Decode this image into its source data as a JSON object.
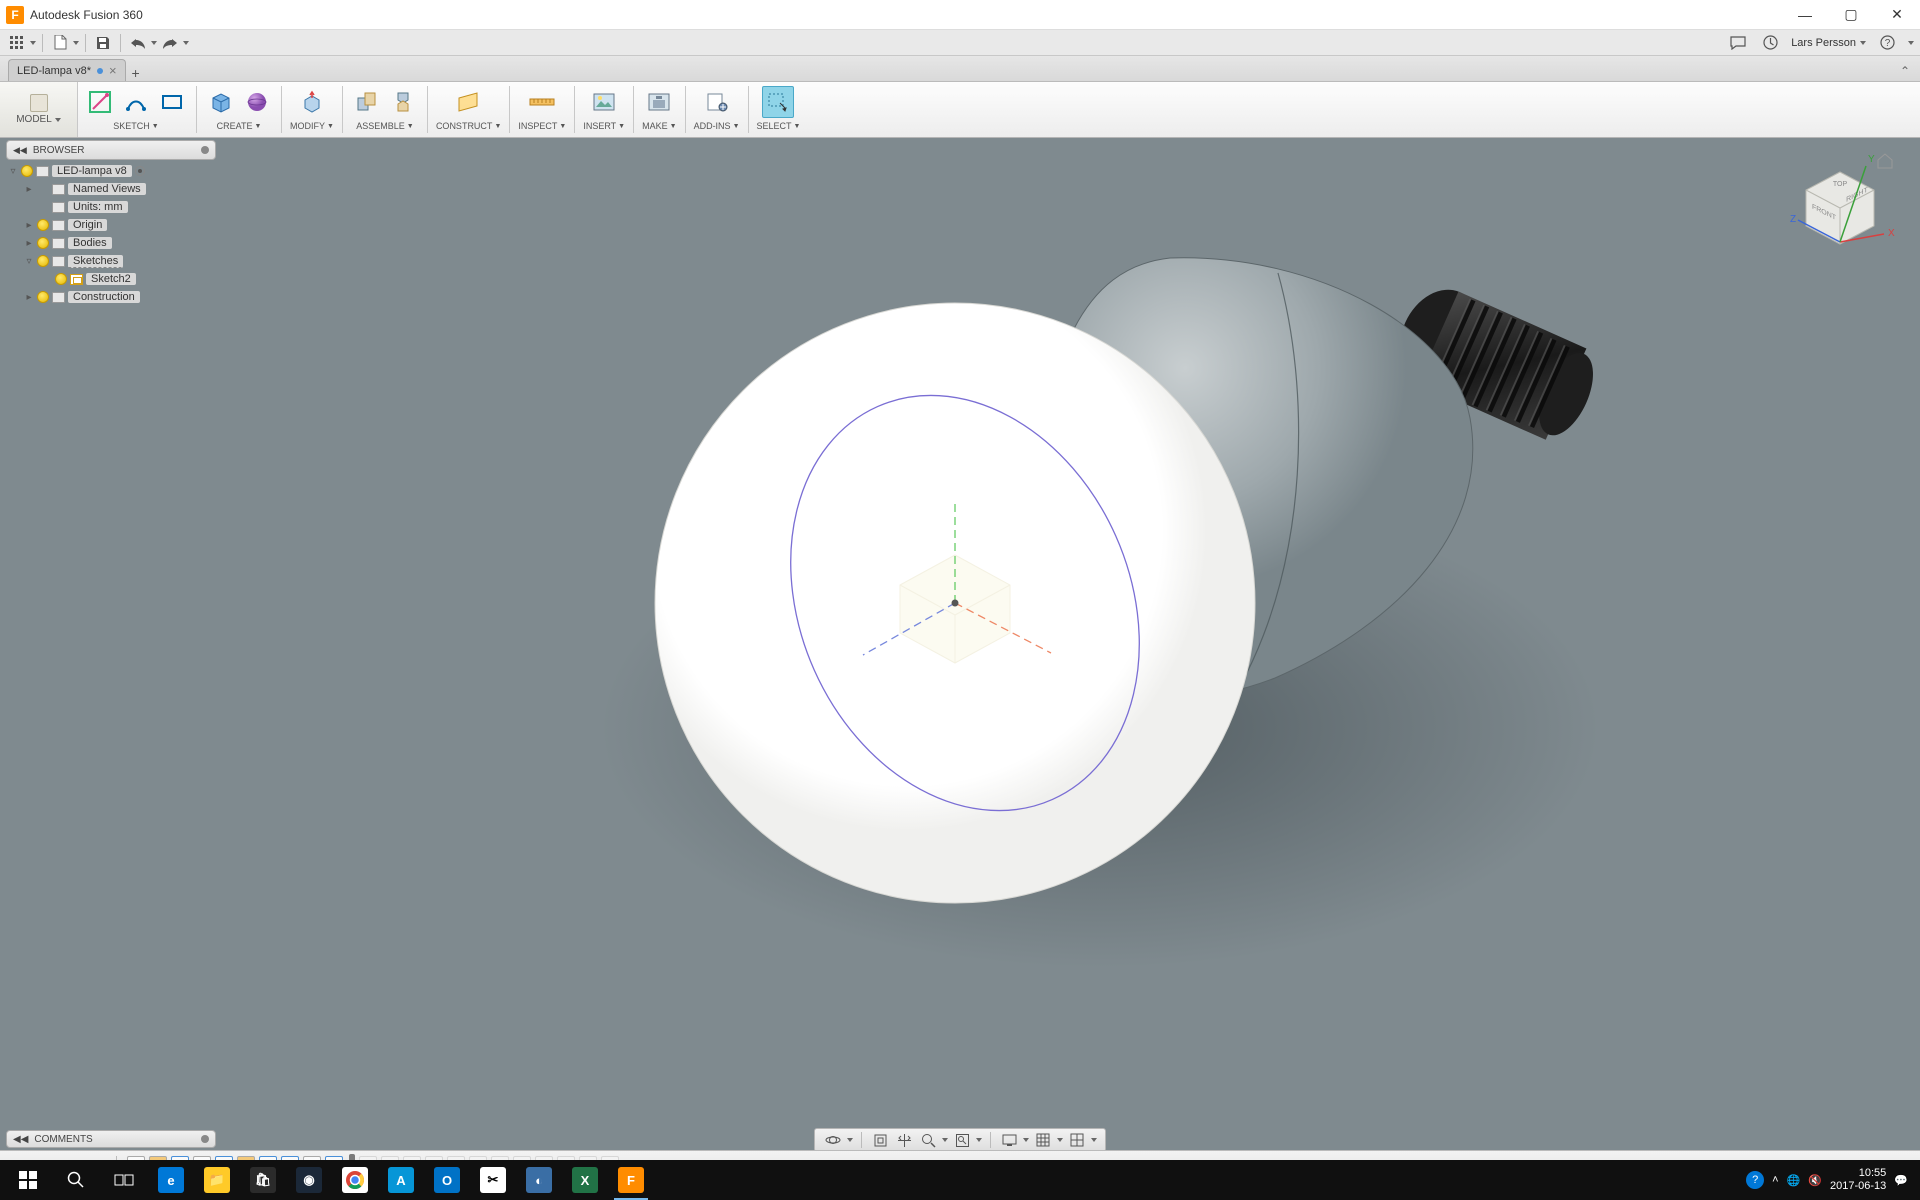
{
  "app": {
    "title": "Autodesk Fusion 360"
  },
  "user": {
    "name": "Lars Persson"
  },
  "document": {
    "tab_name": "LED-lampa v8*"
  },
  "workspace": {
    "label": "MODEL"
  },
  "ribbon": {
    "sketch": "SKETCH",
    "create": "CREATE",
    "modify": "MODIFY",
    "assemble": "ASSEMBLE",
    "construct": "CONSTRUCT",
    "inspect": "INSPECT",
    "insert": "INSERT",
    "make": "MAKE",
    "addins": "ADD-INS",
    "select": "SELECT"
  },
  "browser": {
    "title": "BROWSER",
    "root": "LED-lampa v8",
    "named_views": "Named Views",
    "units": "Units: mm",
    "origin": "Origin",
    "bodies": "Bodies",
    "sketches": "Sketches",
    "sketch2": "Sketch2",
    "construction": "Construction"
  },
  "comments": {
    "title": "COMMENTS"
  },
  "viewcube": {
    "top": "TOP",
    "front": "FRONT",
    "right": "RIGHT",
    "axes": {
      "x": "X",
      "y": "Y",
      "z": "Z"
    }
  },
  "taskbar": {
    "time": "10:55",
    "date": "2017-06-13"
  }
}
